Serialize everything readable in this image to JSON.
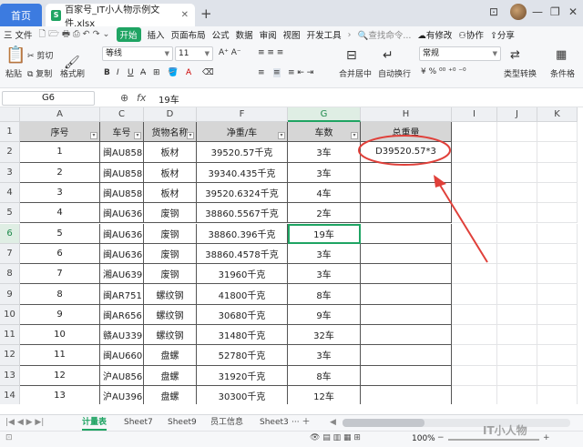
{
  "titlebar": {
    "home_tab": "首页",
    "file_tab": "百家号_IT小人物示例文件.xlsx",
    "file_icon": "S"
  },
  "menu": {
    "file": "三 文件",
    "items": [
      "插入",
      "页面布局",
      "公式",
      "数据",
      "审阅",
      "视图",
      "开发工具"
    ],
    "start": "开始",
    "search": "查找命令...",
    "right": [
      "有修改",
      "协作",
      "分享"
    ]
  },
  "ribbon": {
    "paste": "粘贴",
    "cut": "剪切",
    "copy": "复制",
    "format_painter": "格式刷",
    "font": "等线",
    "size": "11",
    "merge": "合并居中",
    "wrap": "自动换行",
    "numfmt": "常规",
    "type_conv": "类型转换",
    "cond_fmt": "条件格"
  },
  "formula": {
    "cell_ref": "G6",
    "fx": "fx",
    "value": "19车"
  },
  "grid": {
    "columns": [
      "A",
      "C",
      "D",
      "F",
      "G",
      "H",
      "I",
      "J",
      "K"
    ],
    "rows": [
      "1",
      "2",
      "3",
      "4",
      "5",
      "6",
      "7",
      "8",
      "9",
      "10",
      "11",
      "12",
      "13",
      "14"
    ],
    "headers": [
      "序号",
      "车号",
      "货物名称",
      "净重/车",
      "车数",
      "总重量"
    ],
    "data": [
      [
        "1",
        "闽AU858",
        "板材",
        "39520.57千克",
        "3车",
        "D39520.57*3"
      ],
      [
        "2",
        "闽AU858",
        "板材",
        "39340.435千克",
        "3车",
        ""
      ],
      [
        "3",
        "闽AU858",
        "板材",
        "39520.6324千克",
        "4车",
        ""
      ],
      [
        "4",
        "闽AU636",
        "废钢",
        "38860.5567千克",
        "2车",
        ""
      ],
      [
        "5",
        "闽AU636",
        "废钢",
        "38860.396千克",
        "19车",
        ""
      ],
      [
        "6",
        "闽AU636",
        "废钢",
        "38860.4578千克",
        "3车",
        ""
      ],
      [
        "7",
        "湘AU639",
        "废钢",
        "31960千克",
        "3车",
        ""
      ],
      [
        "8",
        "闽AR751",
        "螺纹钢",
        "41800千克",
        "8车",
        ""
      ],
      [
        "9",
        "闽AR656",
        "螺纹钢",
        "30680千克",
        "9车",
        ""
      ],
      [
        "10",
        "赣AU339",
        "螺纹钢",
        "31480千克",
        "32车",
        ""
      ],
      [
        "11",
        "闽AU660",
        "盘螺",
        "52780千克",
        "3车",
        ""
      ],
      [
        "12",
        "沪AU856",
        "盘螺",
        "31920千克",
        "8车",
        ""
      ],
      [
        "13",
        "沪AU396",
        "盘螺",
        "30300千克",
        "12车",
        ""
      ]
    ]
  },
  "sheets": {
    "tabs": [
      "计量表",
      "Sheet7",
      "Sheet9",
      "员工信息",
      "Sheet3"
    ],
    "active": "计量表"
  },
  "status": {
    "zoom": "100%",
    "watermark": "IT小人物"
  },
  "colors": {
    "accent": "#1fa463",
    "annotation": "#e0403a",
    "header_fill": "#d6d6d6",
    "home_tab": "#3c7be0"
  }
}
